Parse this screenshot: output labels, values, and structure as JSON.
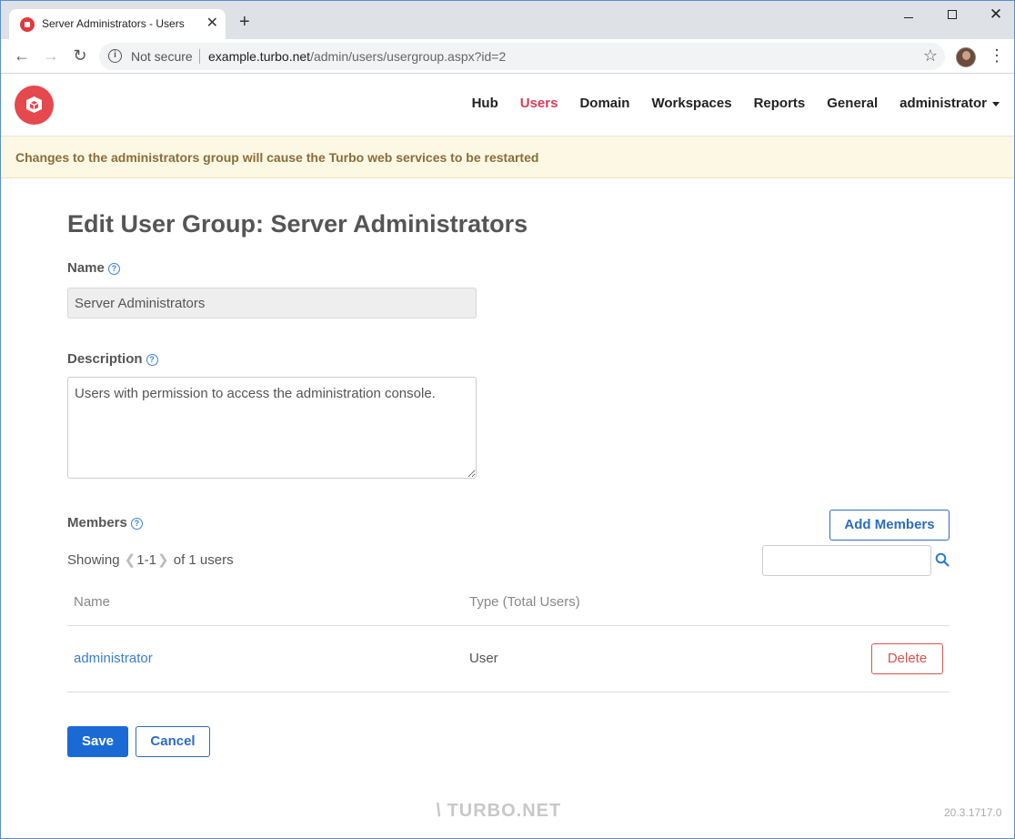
{
  "browser": {
    "tab_title": "Server Administrators - Users",
    "tab_close": "✕",
    "new_tab": "+",
    "security_label": "Not secure",
    "url_host": "example.turbo.net",
    "url_path": "/admin/users/usergroup.aspx?id=2"
  },
  "nav": {
    "items": [
      {
        "label": "Hub",
        "active": false
      },
      {
        "label": "Users",
        "active": true
      },
      {
        "label": "Domain",
        "active": false
      },
      {
        "label": "Workspaces",
        "active": false
      },
      {
        "label": "Reports",
        "active": false
      },
      {
        "label": "General",
        "active": false
      }
    ],
    "user_menu": "administrator",
    "accent_color": "#e03a57"
  },
  "alert": {
    "text": "Changes to the administrators group will cause the Turbo web services to be restarted"
  },
  "form": {
    "title": "Edit User Group: Server Administrators",
    "name_label": "Name",
    "name_value": "Server Administrators",
    "description_label": "Description",
    "description_value": "Users with permission to access the administration console.",
    "members_label": "Members",
    "add_members_label": "Add Members",
    "showing_label": "Showing",
    "range": "1-1",
    "of_label": "of 1 users",
    "search_placeholder": "",
    "columns": {
      "name": "Name",
      "type": "Type (Total Users)"
    },
    "members": [
      {
        "name": "administrator",
        "type": "User",
        "action": "Delete"
      }
    ],
    "save_label": "Save",
    "cancel_label": "Cancel"
  },
  "footer": {
    "logo_text": "TURBO.NET",
    "version": "20.3.1717.0"
  }
}
